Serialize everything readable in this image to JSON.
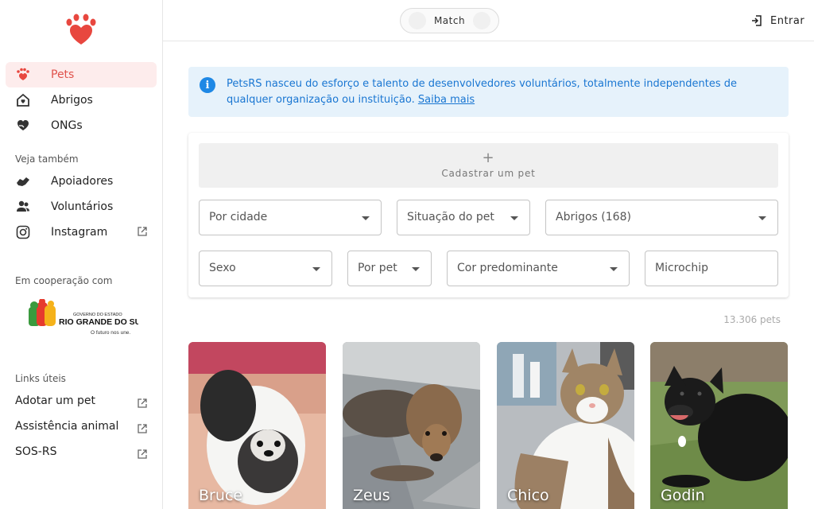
{
  "sidebar": {
    "nav": [
      {
        "label": "Pets",
        "icon": "paw-icon",
        "active": true
      },
      {
        "label": "Abrigos",
        "icon": "house-heart-icon",
        "active": false
      },
      {
        "label": "ONGs",
        "icon": "hand-heart-icon",
        "active": false
      }
    ],
    "see_also_label": "Veja também",
    "see_also": [
      {
        "label": "Apoiadores",
        "icon": "handshake-icon"
      },
      {
        "label": "Voluntários",
        "icon": "people-icon"
      },
      {
        "label": "Instagram",
        "icon": "instagram-icon",
        "external": true
      }
    ],
    "cooperation_label": "Em cooperação com",
    "partner": {
      "line1": "GOVERNO DO ESTADO",
      "line2": "RIO GRANDE DO SUL",
      "line3": "O futuro nos une."
    },
    "useful_links_label": "Links úteis",
    "useful_links": [
      {
        "label": "Adotar um pet"
      },
      {
        "label": "Assistência animal"
      },
      {
        "label": "SOS-RS"
      }
    ]
  },
  "topbar": {
    "match_label": "Match",
    "login_label": "Entrar"
  },
  "banner": {
    "text": "PetsRS nasceu do esforço e talento de desenvolvedores voluntários, totalmente independentes de qualquer organização ou instituição.",
    "link": "Saiba mais"
  },
  "filters": {
    "add_pet_label": "Cadastrar um pet",
    "city": "Por cidade",
    "status": "Situação do pet",
    "shelters": "Abrigos (168)",
    "sex": "Sexo",
    "pet_type": "Por pet",
    "color": "Cor predominante",
    "microchip": "Microchip"
  },
  "results": {
    "count": "13.306 pets"
  },
  "pets": [
    {
      "name": "Bruce"
    },
    {
      "name": "Zeus"
    },
    {
      "name": "Chico"
    },
    {
      "name": "Godin"
    }
  ],
  "colors": {
    "brand": "#e8473f",
    "active_bg": "#fdecec",
    "info_bg": "#e6f2fb",
    "info_text": "#1976d2"
  }
}
